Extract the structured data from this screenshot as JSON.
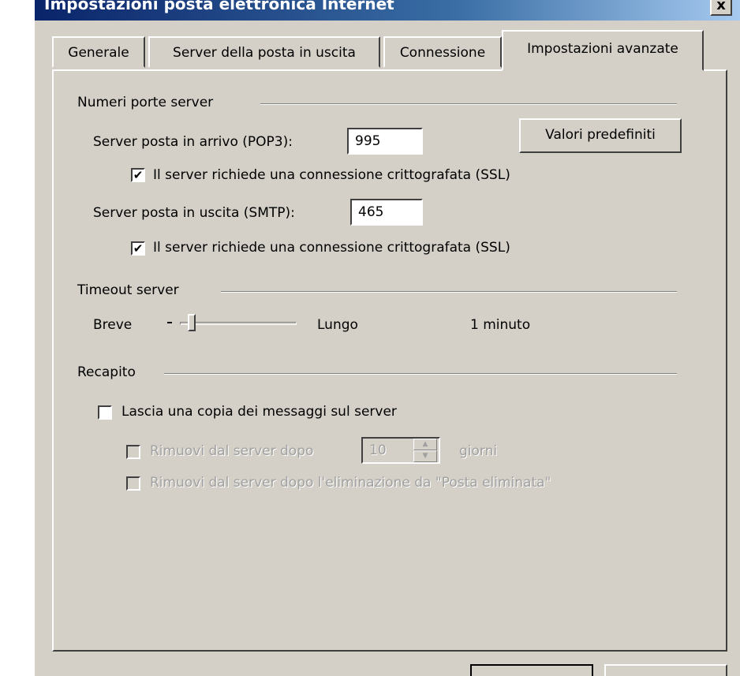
{
  "window": {
    "title": "Impostazioni posta elettronica Internet",
    "close_label": "x"
  },
  "tabs": [
    {
      "label": "Generale"
    },
    {
      "label": "Server della posta in uscita"
    },
    {
      "label": "Connessione"
    },
    {
      "label": "Impostazioni avanzate",
      "active": true
    }
  ],
  "ports": {
    "group_label": "Numeri porte server",
    "incoming_label": "Server posta in arrivo (POP3):",
    "incoming_value": "995",
    "defaults_button": "Valori predefiniti",
    "incoming_ssl_label": "Il server richiede una connessione crittografata (SSL)",
    "incoming_ssl_checked": true,
    "outgoing_label": "Server posta in uscita (SMTP):",
    "outgoing_value": "465",
    "outgoing_ssl_label": "Il server richiede una connessione crittografata (SSL)",
    "outgoing_ssl_checked": true
  },
  "timeout": {
    "group_label": "Timeout server",
    "min_label": "Breve",
    "max_label": "Lungo",
    "value_label": "1 minuto",
    "slider_fraction": 0.1
  },
  "delivery": {
    "group_label": "Recapito",
    "leave_copy_label": "Lascia una copia dei messaggi sul server",
    "leave_copy_checked": false,
    "remove_after_label": "Rimuovi dal server dopo",
    "remove_after_value": "10",
    "days_label": "giorni",
    "remove_deleted_label": "Rimuovi dal server dopo l'eliminazione da \"Posta eliminata\""
  },
  "colors": {
    "dialog_bg": "#d4d0c8",
    "titlebar_start": "#0a246a",
    "titlebar_end": "#a6caf0"
  }
}
